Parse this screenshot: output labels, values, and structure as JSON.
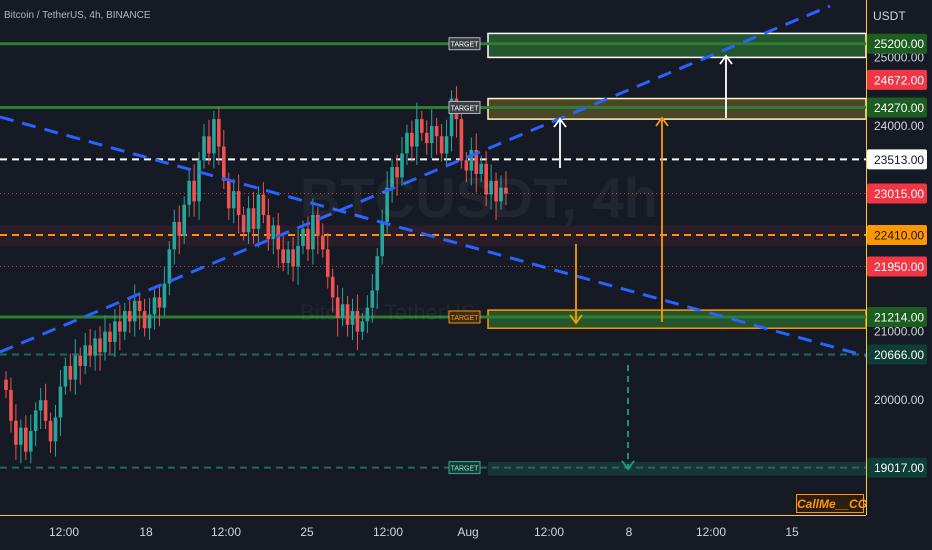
{
  "chart_title": "Bitcoin / TetherUS, 4h, BINANCE",
  "currency_label": "USDT",
  "watermark_symbol": "BTCUSDT, 4h",
  "watermark_name": "Bitcoin / TetherUS",
  "signature": "CallMe__CG",
  "target_label": "TARGET",
  "colors": {
    "background": "#161a25",
    "up": "#26a69a",
    "down": "#ef5350",
    "green_line": "#2e7d32",
    "orange": "#ff9800",
    "blue_dash": "#2962ff",
    "axis_border": "#fcca34"
  },
  "chart_data": {
    "type": "candlestick",
    "title": "Bitcoin / TetherUS, 4h, BINANCE",
    "y_unit": "USDT",
    "ylim": [
      18900,
      25750
    ],
    "y_ticks": [
      20000,
      21000,
      24000,
      25000
    ],
    "x_ticks": [
      "12:00",
      "18",
      "12:00",
      "25",
      "12:00",
      "Aug",
      "12:00",
      "8",
      "12:00",
      "15"
    ],
    "price_badges": [
      {
        "value": "25200.00",
        "bg": "#1b5e20",
        "fg": "#ffffff"
      },
      {
        "value": "24672.00",
        "bg": "#f23645",
        "fg": "#ffffff"
      },
      {
        "value": "24270.00",
        "bg": "#1b5e20",
        "fg": "#ffffff"
      },
      {
        "value": "23513.00",
        "bg": "#ffffff",
        "fg": "#131722"
      },
      {
        "value": "23015.00",
        "bg": "#f23645",
        "fg": "#ffffff"
      },
      {
        "value": "22410.00",
        "bg": "#ff9800",
        "fg": "#131722"
      },
      {
        "value": "21950.00",
        "bg": "#f23645",
        "fg": "#ffffff"
      },
      {
        "value": "21214.00",
        "bg": "#1b5e20",
        "fg": "#ffffff"
      },
      {
        "value": "20666.00",
        "bg": "#0f3d38",
        "fg": "#ffffff"
      },
      {
        "value": "19017.00",
        "bg": "#0f3d38",
        "fg": "#ffffff"
      }
    ],
    "horizontal_levels": [
      {
        "price": 25200,
        "style": "solid",
        "color": "#2e7d32"
      },
      {
        "price": 24270,
        "style": "solid",
        "color": "#2e7d32"
      },
      {
        "price": 23513,
        "style": "dashed",
        "color": "#ffffff"
      },
      {
        "price": 22410,
        "style": "dashed",
        "color": "#ff9800"
      },
      {
        "price": 21214,
        "style": "solid",
        "color": "#2e7d32"
      },
      {
        "price": 20666,
        "style": "dashed",
        "color": "#1e6b5a"
      },
      {
        "price": 19017,
        "style": "dashed",
        "color": "#1e6b5a"
      }
    ],
    "candles_close": [
      20150,
      19700,
      19350,
      19600,
      19250,
      19550,
      19850,
      20000,
      19700,
      19400,
      19750,
      20200,
      20500,
      20300,
      20650,
      20500,
      20800,
      20650,
      20900,
      20700,
      21000,
      20850,
      21150,
      21000,
      21300,
      21150,
      21450,
      21300,
      21050,
      21250,
      21500,
      21350,
      21700,
      22200,
      22600,
      22400,
      22850,
      23200,
      22900,
      23500,
      23850,
      23600,
      24100,
      23700,
      23200,
      22800,
      23050,
      22700,
      22450,
      22800,
      22500,
      23000,
      22700,
      22350,
      22550,
      22200,
      22000,
      22200,
      21950,
      22250,
      22500,
      22200,
      22700,
      22400,
      22200,
      21800,
      21500,
      21200,
      21400,
      21100,
      21300,
      21000,
      21150,
      21350,
      21600,
      22100,
      22600,
      23100,
      23400,
      23250,
      23600,
      23900,
      23700,
      24100,
      23900,
      23750,
      24000,
      23850,
      23600,
      23850,
      24400,
      24100,
      23500,
      23350,
      23650,
      23300,
      23450,
      23000,
      23200,
      22900,
      23100,
      23015
    ]
  }
}
